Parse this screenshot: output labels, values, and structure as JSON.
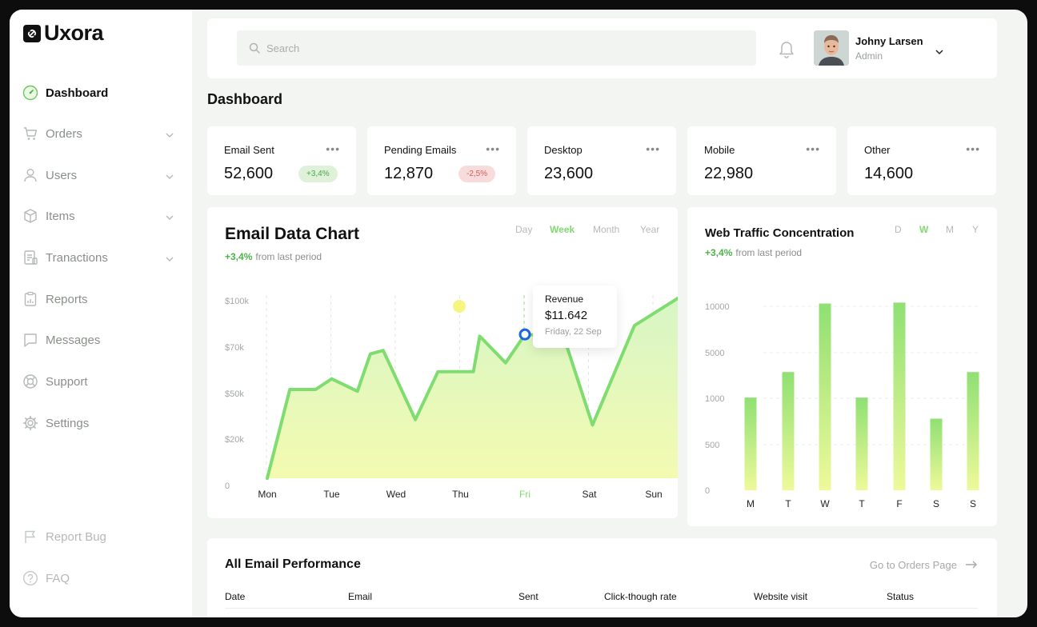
{
  "app": {
    "name": "Uxora"
  },
  "sidebar": {
    "items": [
      {
        "label": "Dashboard",
        "icon": "gauge-icon",
        "active": true
      },
      {
        "label": "Orders",
        "icon": "cart-icon",
        "expandable": true
      },
      {
        "label": "Users",
        "icon": "user-icon",
        "expandable": true
      },
      {
        "label": "Items",
        "icon": "box-icon",
        "expandable": true
      },
      {
        "label": "Tranactions",
        "icon": "receipt-icon",
        "expandable": true
      },
      {
        "label": "Reports",
        "icon": "report-icon"
      },
      {
        "label": "Messages",
        "icon": "message-icon"
      },
      {
        "label": "Support",
        "icon": "lifebuoy-icon"
      },
      {
        "label": "Settings",
        "icon": "gear-icon"
      }
    ],
    "footer": [
      {
        "label": "Report Bug",
        "icon": "flag-icon"
      },
      {
        "label": "FAQ",
        "icon": "question-icon"
      }
    ]
  },
  "topbar": {
    "search_placeholder": "Search",
    "user": {
      "name": "Johny Larsen",
      "role": "Admin"
    }
  },
  "page": {
    "title": "Dashboard"
  },
  "stats": [
    {
      "label": "Email Sent",
      "value": "52,600",
      "badge": "+3,4%",
      "trend": "up"
    },
    {
      "label": "Pending Emails",
      "value": "12,870",
      "badge": "-2,5%",
      "trend": "down"
    },
    {
      "label": "Desktop",
      "value": "23,600"
    },
    {
      "label": "Mobile",
      "value": "22,980"
    },
    {
      "label": "Other",
      "value": "14,600"
    }
  ],
  "email_chart": {
    "title": "Email Data Chart",
    "growth_value": "+3,4%",
    "growth_text": "from last period",
    "tabs": [
      "Day",
      "Week",
      "Month",
      "Year"
    ],
    "active_tab": "Week",
    "tooltip": {
      "label": "Revenue",
      "value": "$11.642",
      "date": "Friday, 22 Sep"
    }
  },
  "traffic_chart": {
    "title": "Web Traffic Concentration",
    "growth_value": "+3,4%",
    "growth_text": "from last period",
    "tabs": [
      "D",
      "W",
      "M",
      "Y"
    ],
    "active_tab": "W"
  },
  "table": {
    "title": "All Email Performance",
    "link": "Go to Orders Page",
    "columns": [
      "Date",
      "Email",
      "Sent",
      "Click-though rate",
      "Website visit",
      "Status"
    ]
  },
  "colors": {
    "accent": "#7fdc6f",
    "accent_dark": "#4fb24a",
    "area_top": "#d7f5c6",
    "area_bottom": "#f3fbb0"
  },
  "chart_data": [
    {
      "type": "area",
      "title": "Email Data Chart",
      "categories": [
        "Mon",
        "Tue",
        "Wed",
        "Thu",
        "Fri",
        "Sat",
        "Sun"
      ],
      "y_ticks": [
        "$100k",
        "$70k",
        "$50k",
        "$20k",
        "0"
      ],
      "highlight_category": "Fri",
      "series": [
        {
          "x": [
            0,
            0.35,
            0.75,
            1.0,
            1.4,
            1.6,
            1.8,
            2.3,
            2.65,
            3.2,
            3.3,
            3.7,
            4.0,
            4.6,
            5.05,
            5.7,
            6.4
          ],
          "values": [
            0,
            50,
            50,
            56,
            49,
            70,
            72,
            33,
            60,
            60,
            80,
            65,
            81,
            80,
            30,
            86,
            102
          ]
        }
      ],
      "ylim": [
        0,
        100
      ]
    },
    {
      "type": "bar",
      "title": "Web Traffic Concentration",
      "categories": [
        "M",
        "T",
        "W",
        "T",
        "F",
        "S",
        "S"
      ],
      "y_ticks": [
        "10000",
        "5000",
        "1000",
        "500",
        "0"
      ],
      "values": [
        1060,
        3300,
        10300,
        1060,
        10400,
        780,
        3300
      ],
      "scale": "categorical-ticks"
    }
  ]
}
